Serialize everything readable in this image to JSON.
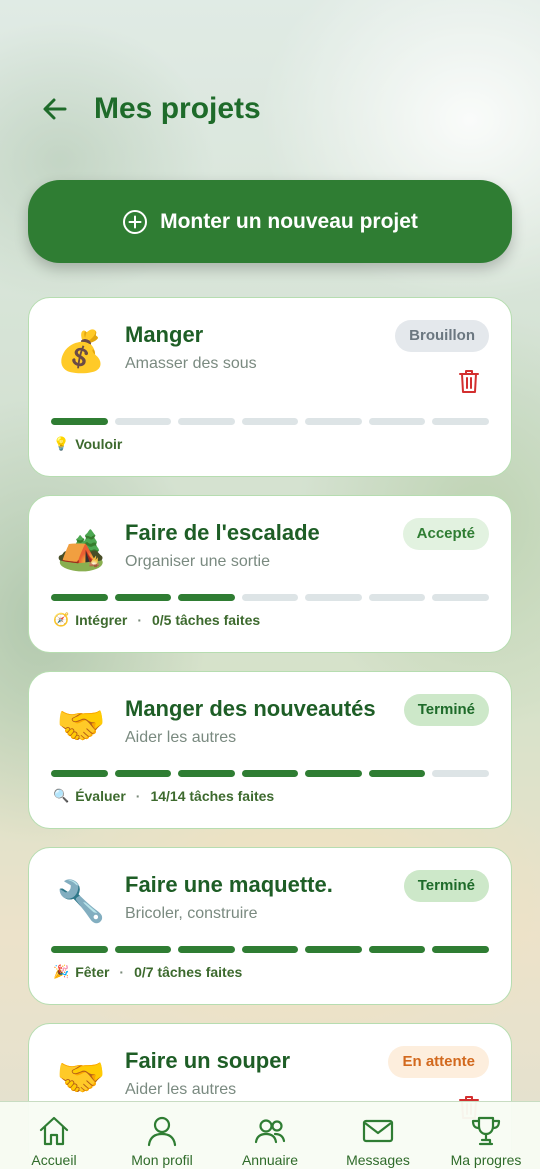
{
  "header": {
    "title": "Mes projets"
  },
  "new_project_button": {
    "label": "Monter un nouveau projet"
  },
  "projects": [
    {
      "emoji": "💰",
      "icon": "money-bag-icon",
      "title": "Manger",
      "subtitle": "Amasser des sous",
      "status": "Brouillon",
      "status_type": "draft",
      "progress_filled": 1,
      "progress_total": 7,
      "stage_emoji": "💡",
      "stage": "Vouloir",
      "tasks": "",
      "deletable": true
    },
    {
      "emoji": "🏕️",
      "icon": "camping-icon",
      "title": "Faire de l'escalade",
      "subtitle": "Organiser une sortie",
      "status": "Accepté",
      "status_type": "accepted",
      "progress_filled": 3,
      "progress_total": 7,
      "stage_emoji": "🧭",
      "stage": "Intégrer",
      "tasks": "0/5 tâches faites",
      "deletable": false
    },
    {
      "emoji": "🤝",
      "icon": "handshake-icon",
      "title": "Manger des nouveautés",
      "subtitle": "Aider les autres",
      "status": "Terminé",
      "status_type": "done",
      "progress_filled": 6,
      "progress_total": 7,
      "stage_emoji": "🔍",
      "stage": "Évaluer",
      "tasks": "14/14 tâches faites",
      "deletable": false
    },
    {
      "emoji": "🔧",
      "icon": "wrench-icon",
      "title": "Faire une maquette.",
      "subtitle": "Bricoler, construire",
      "status": "Terminé",
      "status_type": "done",
      "progress_filled": 7,
      "progress_total": 7,
      "stage_emoji": "🎉",
      "stage": "Fêter",
      "tasks": "0/7 tâches faites",
      "deletable": false
    },
    {
      "emoji": "🤝",
      "icon": "handshake-icon",
      "title": "Faire un souper",
      "subtitle": "Aider les autres",
      "status": "En attente",
      "status_type": "pending",
      "progress_filled": 0,
      "progress_total": 7,
      "stage_emoji": "",
      "stage": "",
      "tasks": "",
      "deletable": true
    }
  ],
  "bottom_nav": [
    {
      "label": "Accueil",
      "icon": "home-icon"
    },
    {
      "label": "Mon profil",
      "icon": "user-icon"
    },
    {
      "label": "Annuaire",
      "icon": "users-icon"
    },
    {
      "label": "Messages",
      "icon": "mail-icon"
    },
    {
      "label": "Ma progres",
      "icon": "trophy-icon"
    }
  ],
  "colors": {
    "primary": "#2f7d33",
    "title": "#1e6b2a",
    "danger": "#d32f2f"
  }
}
